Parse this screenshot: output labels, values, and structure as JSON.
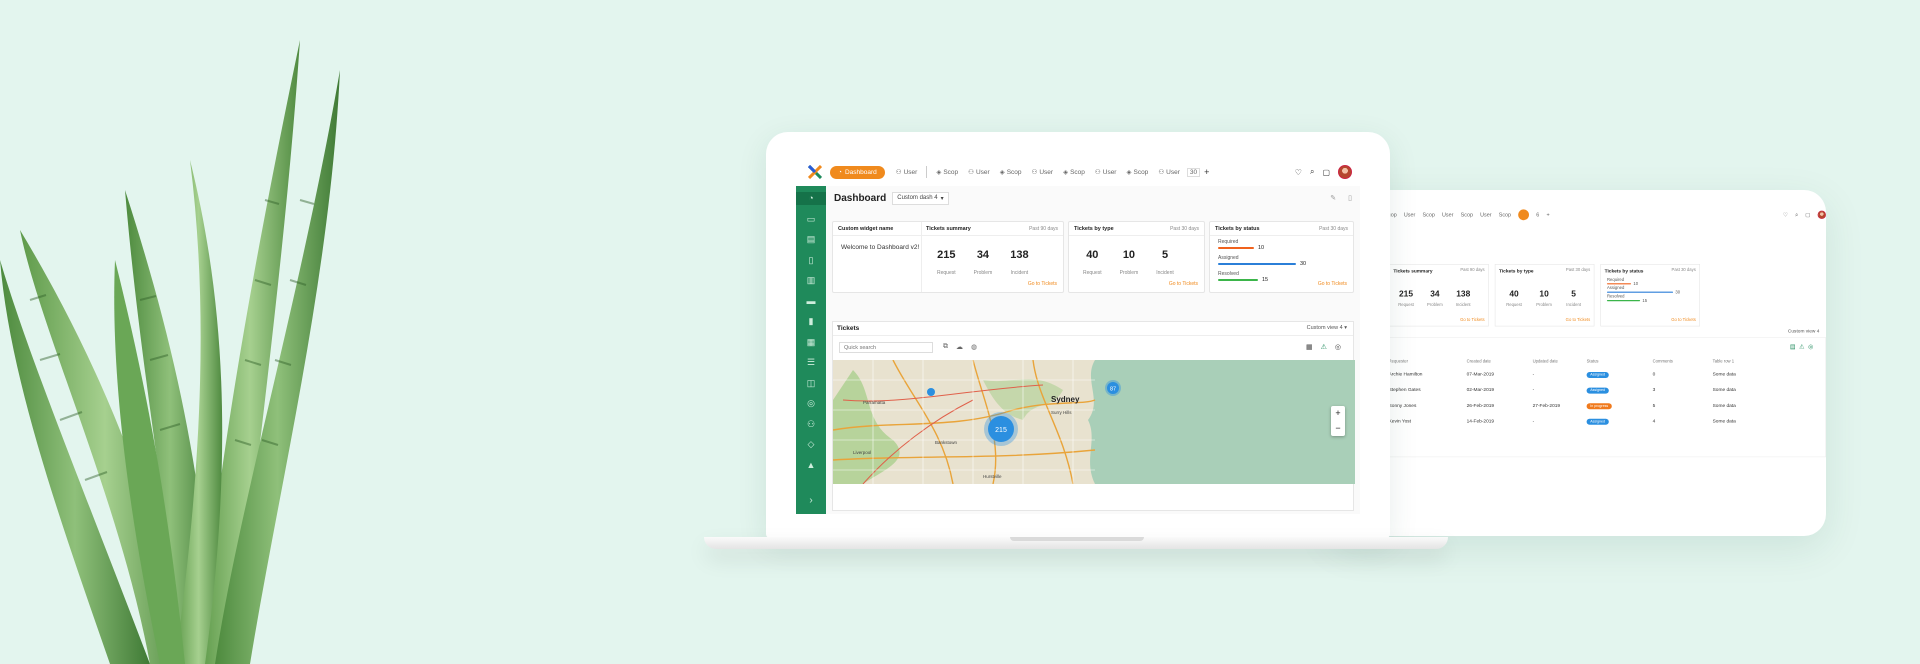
{
  "topbar": {
    "dashboard_label": "Dashboard",
    "items": [
      "User",
      "Scop",
      "User",
      "Scop",
      "User",
      "Scop",
      "User",
      "Scop",
      "User"
    ],
    "count": "30"
  },
  "dashboard": {
    "title": "Dashboard",
    "selector": "Custom dash 4"
  },
  "custom_widget": {
    "title": "Custom widget name",
    "text": "Welcome to Dashboard v2!"
  },
  "tickets_summary": {
    "title": "Tickets summary",
    "period": "Past 90 days",
    "stats": [
      {
        "value": "215",
        "label": "Request"
      },
      {
        "value": "34",
        "label": "Problem"
      },
      {
        "value": "138",
        "label": "Incident"
      }
    ],
    "link": "Go to Tickets"
  },
  "tickets_by_type": {
    "title": "Tickets by type",
    "period": "Past 30 days",
    "stats": [
      {
        "value": "40",
        "label": "Request"
      },
      {
        "value": "10",
        "label": "Problem"
      },
      {
        "value": "5",
        "label": "Incident"
      }
    ],
    "link": "Go to Tickets"
  },
  "tickets_by_status": {
    "title": "Tickets by status",
    "period": "Past 30 days",
    "rows": [
      {
        "label": "Required",
        "value": "10",
        "fraction": 0.33,
        "color": "#f0621d"
      },
      {
        "label": "Assigned",
        "value": "30",
        "fraction": 1.0,
        "color": "#2b7fd8"
      },
      {
        "label": "Resolved",
        "value": "15",
        "fraction": 0.5,
        "color": "#3bb54a"
      }
    ],
    "link": "Go to Tickets"
  },
  "tickets": {
    "title": "Tickets",
    "view": "Custom view 4",
    "search_placeholder": "Quick search"
  },
  "map": {
    "clusters": [
      "215",
      "87"
    ],
    "labels": [
      "Sydney",
      "Surry Hills",
      "Parramatta",
      "Bankstown",
      "Liverpool",
      "Hurstville"
    ],
    "zoom_in": "+",
    "zoom_out": "−"
  },
  "tablet": {
    "topbar_items": [
      "Scop",
      "User",
      "Scop",
      "User",
      "Scop",
      "User",
      "Scop"
    ],
    "counter": "6",
    "view": "Custom view 4",
    "tickets_summary": {
      "title": "Tickets summary",
      "period": "Past 90 days",
      "stats": [
        {
          "value": "215",
          "label": "Request"
        },
        {
          "value": "34",
          "label": "Problem"
        },
        {
          "value": "138",
          "label": "Incident"
        }
      ],
      "link": "Go to Tickets"
    },
    "tickets_by_type": {
      "title": "Tickets by type",
      "period": "Past 30 days",
      "stats": [
        {
          "value": "40",
          "label": "Request"
        },
        {
          "value": "10",
          "label": "Problem"
        },
        {
          "value": "5",
          "label": "Incident"
        }
      ],
      "link": "Go to Tickets"
    },
    "tickets_by_status": {
      "title": "Tickets by status",
      "period": "Past 30 days",
      "rows": [
        {
          "label": "Required",
          "value": "10"
        },
        {
          "label": "Assigned",
          "value": "30"
        },
        {
          "label": "Resolved",
          "value": "15"
        }
      ],
      "link": "Go to Tickets"
    },
    "columns": [
      "Requester",
      "Created date",
      "Updated date",
      "Status",
      "Comments",
      "Table row 1"
    ],
    "rows": [
      {
        "requester": "Archie Hamilton",
        "created": "07-Mar-2019",
        "updated": "-",
        "status": "Assigned",
        "status_color": "#2b8fe0",
        "comments": "0",
        "extra": "Some data"
      },
      {
        "requester": "Stephen Gates",
        "created": "02-Mar-2019",
        "updated": "-",
        "status": "Assigned",
        "status_color": "#2b8fe0",
        "comments": "3",
        "extra": "Some data"
      },
      {
        "requester": "Sonny Jones",
        "created": "26-Feb-2019",
        "updated": "27-Feb-2019",
        "status": "In progress",
        "status_color": "#f07a1d",
        "comments": "5",
        "extra": "Some data"
      },
      {
        "requester": "Kevin Yost",
        "created": "14-Feb-2019",
        "updated": "-",
        "status": "Assigned",
        "status_color": "#2b8fe0",
        "comments": "4",
        "extra": "Some data"
      }
    ]
  }
}
